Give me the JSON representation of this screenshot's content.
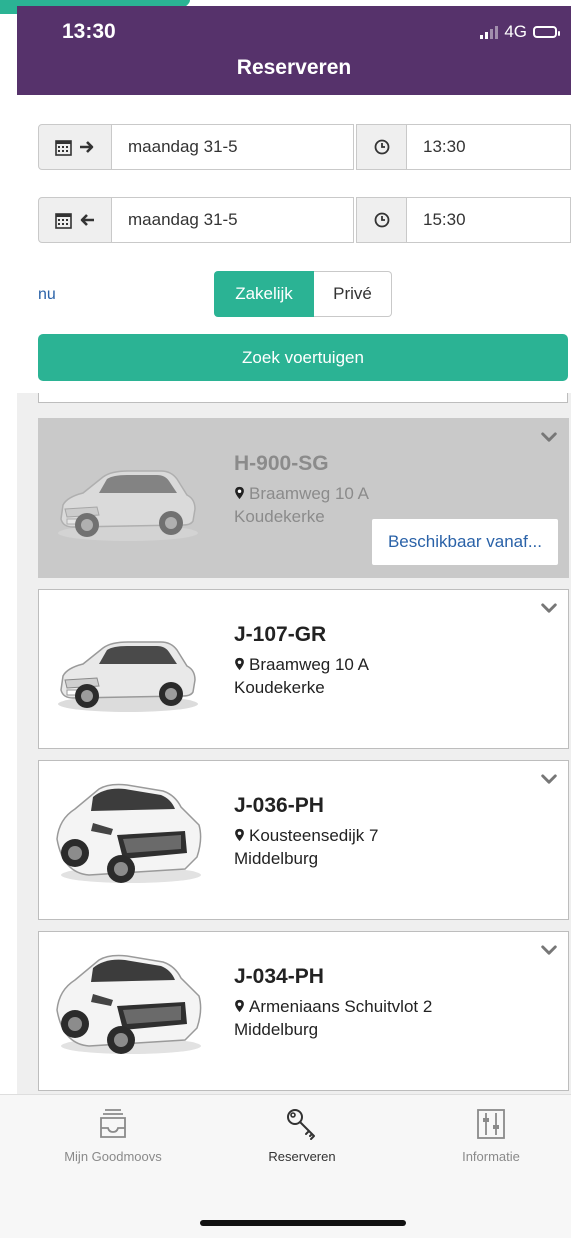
{
  "colors": {
    "brand_purple": "#56326b",
    "accent_green": "#2bb394",
    "link_blue": "#2a62a8"
  },
  "status_bar": {
    "time": "13:30",
    "network": "4G"
  },
  "header": {
    "title": "Reserveren"
  },
  "pickup": {
    "date": "maandag 31-5",
    "time": "13:30",
    "icon": "calendar-arrow-right-icon"
  },
  "return": {
    "date": "maandag 31-5",
    "time": "15:30",
    "icon": "calendar-arrow-left-icon"
  },
  "now_link": "nu",
  "usage_toggle": {
    "options": [
      "Zakelijk",
      "Privé"
    ],
    "selected": "Zakelijk"
  },
  "search_button": "Zoek voertuigen",
  "vehicles": [
    {
      "plate": "H-900-SG",
      "address": "Braamweg 10 A",
      "city": "Koudekerke",
      "available": false,
      "availability_label": "Beschikbaar vanaf..."
    },
    {
      "plate": "J-107-GR",
      "address": "Braamweg 10 A",
      "city": "Koudekerke",
      "available": true
    },
    {
      "plate": "J-036-PH",
      "address": "Kousteensedijk 7",
      "city": "Middelburg",
      "available": true
    },
    {
      "plate": "J-034-PH",
      "address": "Armeniaans Schuitvlot 2",
      "city": "Middelburg",
      "available": true
    }
  ],
  "tabs": [
    {
      "label": "Mijn Goodmoovs",
      "icon": "inbox-icon",
      "active": false
    },
    {
      "label": "Reserveren",
      "icon": "key-icon",
      "active": true
    },
    {
      "label": "Informatie",
      "icon": "sliders-icon",
      "active": false
    }
  ]
}
